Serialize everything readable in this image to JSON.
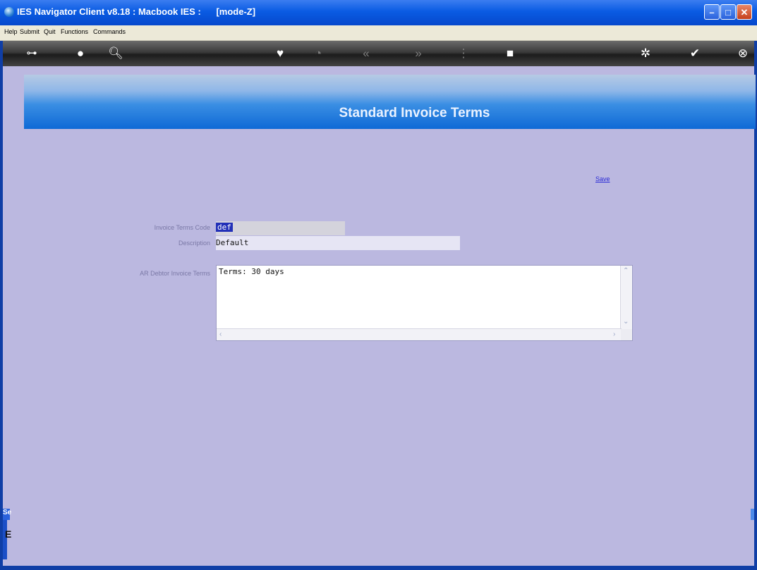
{
  "window": {
    "title": "IES Navigator Client v8.18 : Macbook IES :      [mode-Z]",
    "minimize_label": "–",
    "maximize_label": "□",
    "close_label": "✕"
  },
  "menu": {
    "items": [
      {
        "label": "Help"
      },
      {
        "label": "Submit"
      },
      {
        "label": "Quit"
      },
      {
        "label": "Functions"
      },
      {
        "label": "Commands"
      }
    ]
  },
  "toolbar": {
    "icons": [
      "key-icon",
      "help-icon",
      "search-icon",
      "heart-icon",
      "clock-icon",
      "rewind-icon",
      "forward-icon",
      "tree-icon",
      "stop-icon",
      "settings-icon",
      "check-icon",
      "close-icon"
    ]
  },
  "banner": {
    "title": "Standard Invoice Terms"
  },
  "actions": {
    "save_label": "Save"
  },
  "form": {
    "code_label": "Invoice Terms Code",
    "code_value": "def",
    "description_label": "Description",
    "description_value": "Default",
    "terms_label": "AR Debtor Invoice Terms",
    "terms_value": "Terms: 30 days"
  },
  "side": {
    "tab_label": "Se",
    "glyph": "E"
  }
}
